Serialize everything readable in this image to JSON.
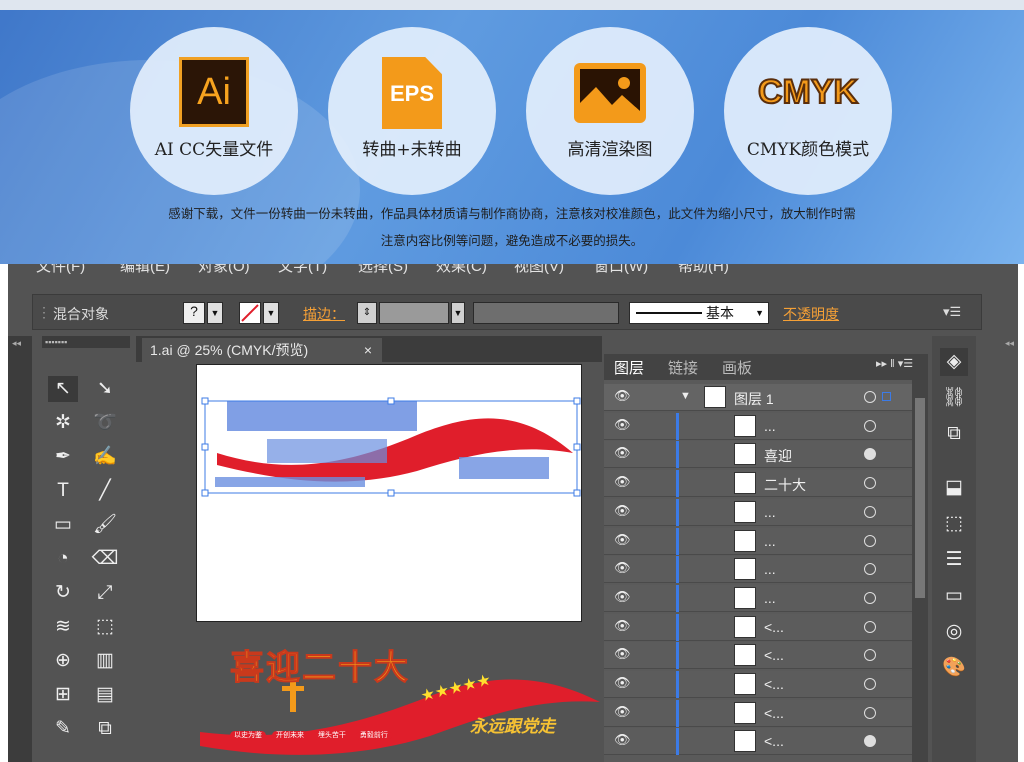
{
  "banner": {
    "features": [
      {
        "icon": "ai-file-icon",
        "icon_text": "Ai",
        "label": "AI CC矢量文件"
      },
      {
        "icon": "eps-file-icon",
        "icon_text": "EPS",
        "label": "转曲+未转曲"
      },
      {
        "icon": "image-icon",
        "icon_text": "",
        "label": "高清渲染图"
      },
      {
        "icon": "cmyk-icon",
        "icon_text": "CMYK",
        "label": "CMYK颜色模式"
      }
    ],
    "note_line1": "感谢下载，文件一份转曲一份未转曲，作品具体材质请与制作商协商，注意核对校准颜色，此文件为缩小尺寸，放大制作时需",
    "note_line2": "注意内容比例等问题，避免造成不必要的损失。"
  },
  "menu": [
    "文件(F)",
    "编辑(E)",
    "对象(O)",
    "文字(T)",
    "选择(S)",
    "效果(C)",
    "视图(V)",
    "窗口(W)",
    "帮助(H)"
  ],
  "control": {
    "selection": "混合对象",
    "stroke_label": "描边：",
    "style": "基本",
    "opacity_label": "不透明度"
  },
  "document": {
    "tab_title": "1.ai @ 25% (CMYK/预览)",
    "close_glyph": "×"
  },
  "artwork": {
    "title": "喜迎二十大",
    "slogan": "永远跟党走",
    "stars": "★★★★★",
    "tags": [
      "以史为鉴",
      "开创未来",
      "埋头苦干",
      "勇毅前行"
    ]
  },
  "layers_panel": {
    "tabs": [
      "图层",
      "链接",
      "画板"
    ],
    "rows": [
      {
        "name": "图层 1",
        "filled": false,
        "top": true
      },
      {
        "name": "...",
        "filled": false
      },
      {
        "name": "喜迎",
        "filled": true
      },
      {
        "name": "二十大",
        "filled": false
      },
      {
        "name": "...",
        "filled": false
      },
      {
        "name": "...",
        "filled": false
      },
      {
        "name": "...",
        "filled": false
      },
      {
        "name": "...",
        "filled": false
      },
      {
        "name": "<...",
        "filled": false
      },
      {
        "name": "<...",
        "filled": false
      },
      {
        "name": "<...",
        "filled": false
      },
      {
        "name": "<...",
        "filled": false
      },
      {
        "name": "<...",
        "filled": true
      }
    ]
  },
  "colors": {
    "accent_orange": "#f39a1a",
    "selection_blue": "#3c7be6",
    "art_red": "#e01e2b"
  }
}
